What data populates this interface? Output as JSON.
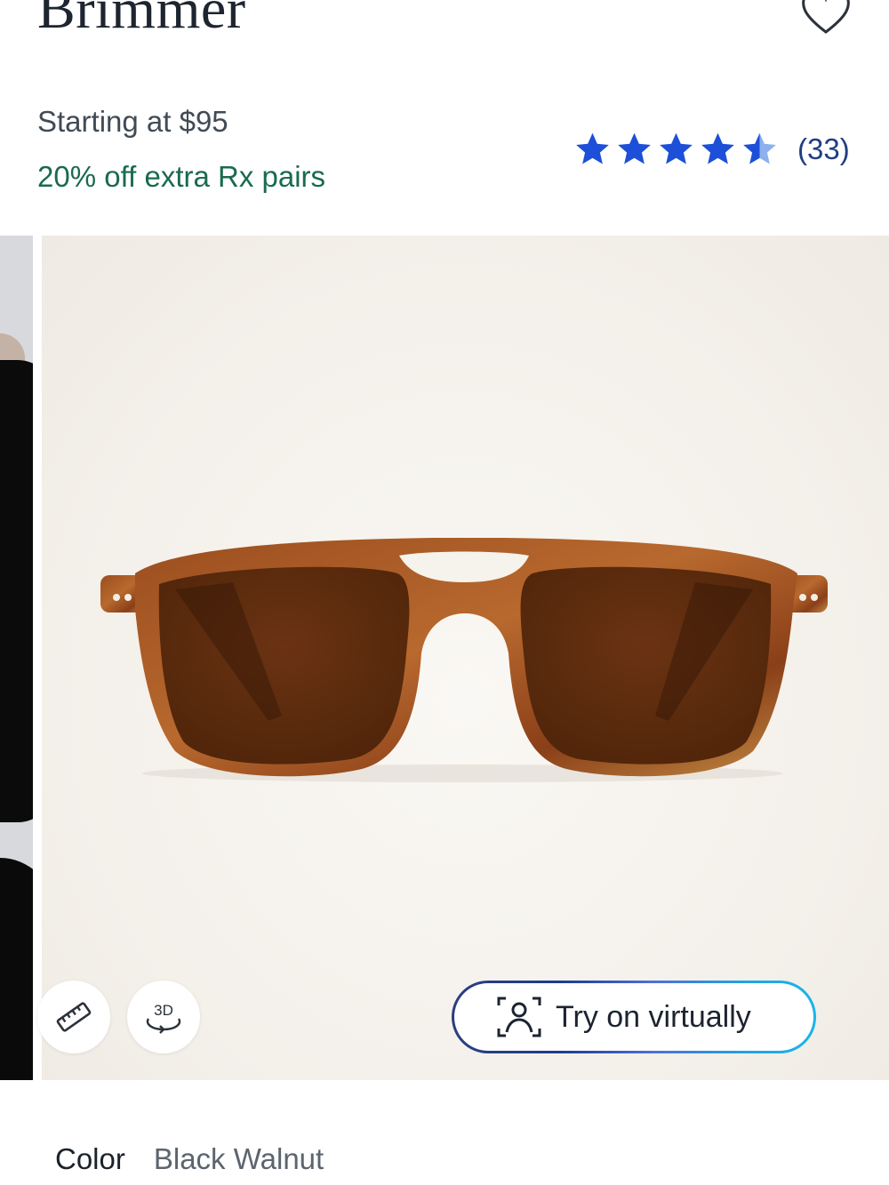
{
  "product": {
    "name": "Brimmer",
    "price": "Starting at $95",
    "promo": "20% off extra Rx pairs"
  },
  "rating": {
    "value": 4.5,
    "max": 5,
    "count_label": "(33)",
    "star_color": "#1d4fd8",
    "star_half_color": "#8fb0ee"
  },
  "gallery": {
    "tools": [
      {
        "name": "measure",
        "icon": "ruler-icon"
      },
      {
        "name": "view-3d",
        "icon": "3d-rotate-icon",
        "label": "3D"
      }
    ],
    "try_on": {
      "icon": "face-scan-icon",
      "label": "Try on virtually"
    }
  },
  "color": {
    "label": "Color",
    "value": "Black Walnut"
  },
  "icons": {
    "favorite": "heart-icon"
  },
  "colors": {
    "promo": "#1a6b4d",
    "title": "#1d2530"
  }
}
